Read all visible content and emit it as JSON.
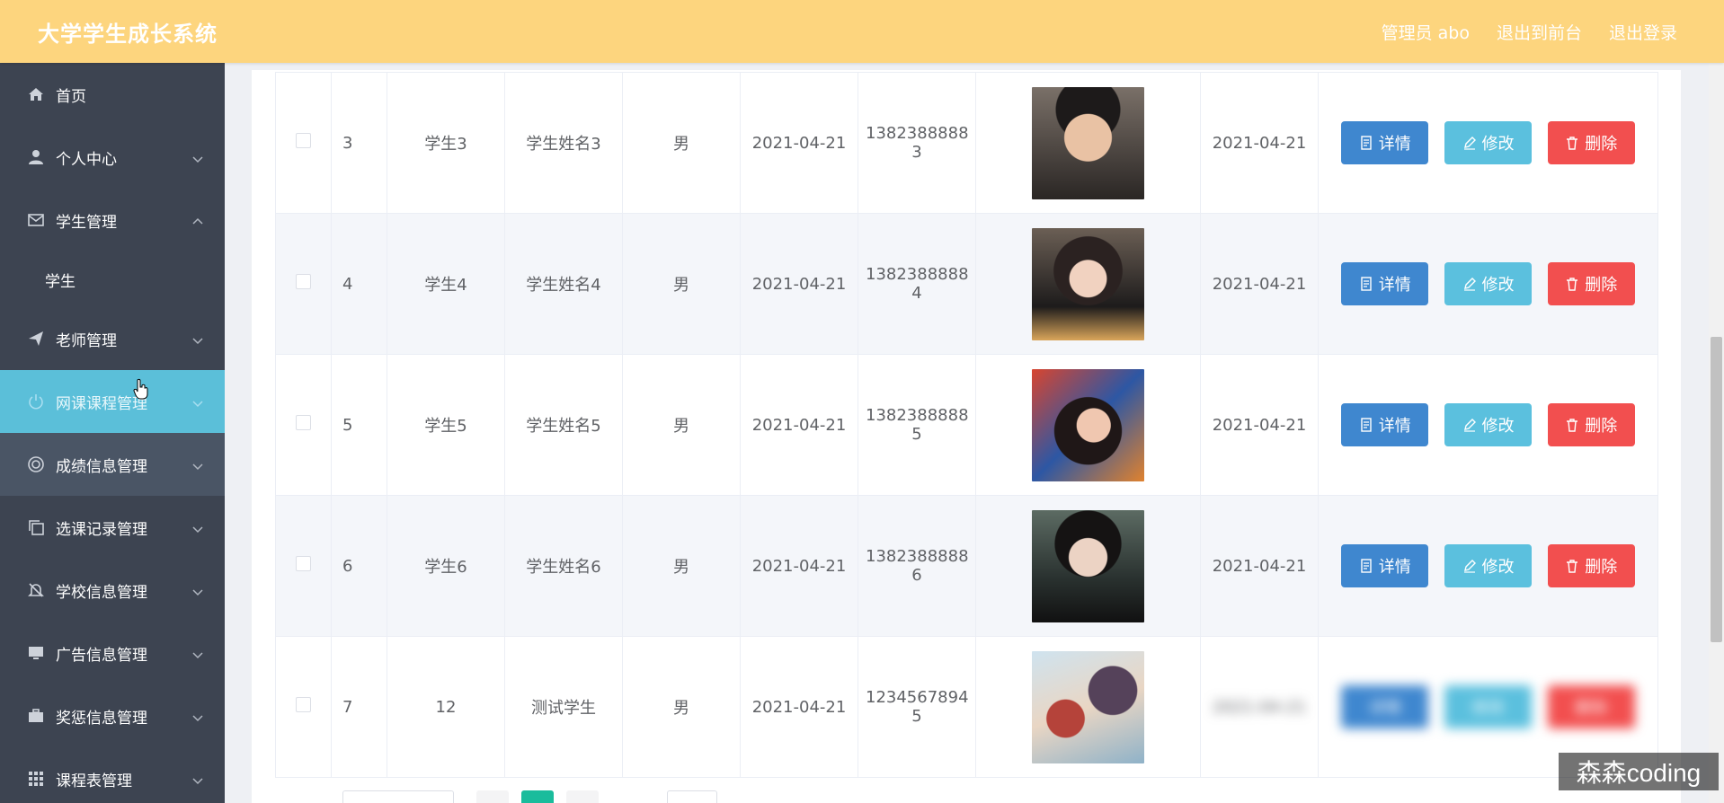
{
  "header": {
    "title": "大学学生成长系统",
    "user_label": "管理员 abo",
    "front_link": "退出到前台",
    "logout_link": "退出登录"
  },
  "sidebar": {
    "items": [
      {
        "label": "首页",
        "icon": "home-icon"
      },
      {
        "label": "个人中心",
        "icon": "user-icon"
      },
      {
        "label": "学生管理",
        "icon": "mail-icon",
        "expanded": true
      },
      {
        "label": "学生",
        "icon": ""
      },
      {
        "label": "老师管理",
        "icon": "send-icon"
      },
      {
        "label": "网课课程管理",
        "icon": "power-icon",
        "active": true
      },
      {
        "label": "成绩信息管理",
        "icon": "lifebuoy-icon"
      },
      {
        "label": "选课记录管理",
        "icon": "copy-icon"
      },
      {
        "label": "学校信息管理",
        "icon": "bell-off-icon"
      },
      {
        "label": "广告信息管理",
        "icon": "monitor-icon"
      },
      {
        "label": "奖惩信息管理",
        "icon": "briefcase-icon"
      },
      {
        "label": "课程表管理",
        "icon": "grid-icon"
      }
    ]
  },
  "table": {
    "rows": [
      {
        "idx": "3",
        "account": "学生3",
        "name": "学生姓名3",
        "gender": "男",
        "birth": "2021-04-21",
        "phone_a": "1382388888",
        "phone_b": "3",
        "date": "2021-04-21"
      },
      {
        "idx": "4",
        "account": "学生4",
        "name": "学生姓名4",
        "gender": "男",
        "birth": "2021-04-21",
        "phone_a": "1382388888",
        "phone_b": "4",
        "date": "2021-04-21"
      },
      {
        "idx": "5",
        "account": "学生5",
        "name": "学生姓名5",
        "gender": "男",
        "birth": "2021-04-21",
        "phone_a": "1382388888",
        "phone_b": "5",
        "date": "2021-04-21"
      },
      {
        "idx": "6",
        "account": "学生6",
        "name": "学生姓名6",
        "gender": "男",
        "birth": "2021-04-21",
        "phone_a": "1382388888",
        "phone_b": "6",
        "date": "2021-04-21"
      },
      {
        "idx": "7",
        "account": "12",
        "name": "测试学生",
        "gender": "男",
        "birth": "2021-04-21",
        "phone_a": "1234567894",
        "phone_b": "5",
        "date": "2021-04-21"
      }
    ],
    "buttons": {
      "detail": "详情",
      "edit": "修改",
      "delete": "删除"
    }
  },
  "watermark": "森森coding",
  "colors": {
    "header_bg": "#fdd57e",
    "sidebar_bg": "#3d4451",
    "active_item": "#5bbfd9",
    "btn_detail": "#3f87cf",
    "btn_edit": "#5bc0de",
    "btn_delete": "#f24f4f",
    "pager_active": "#1abc9c"
  }
}
